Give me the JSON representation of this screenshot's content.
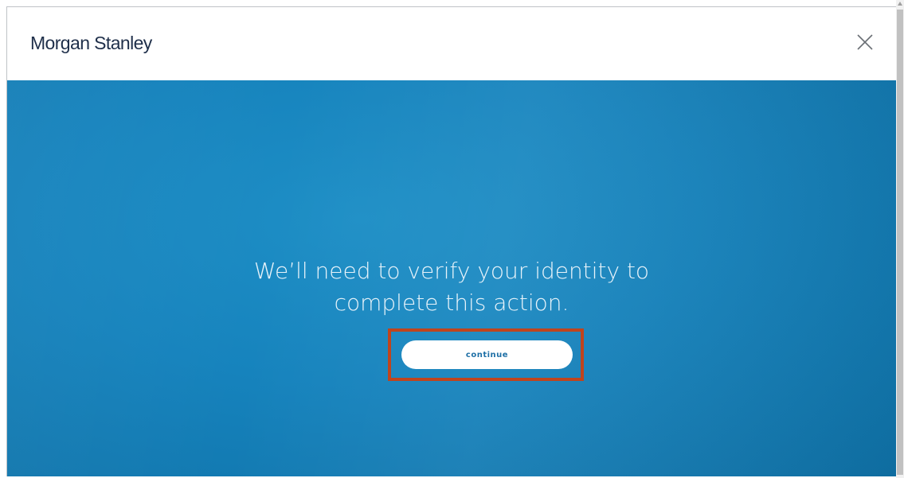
{
  "header": {
    "logo_text": "Morgan Stanley",
    "close_icon": "close-icon"
  },
  "hero": {
    "message_line1": "We’ll need to verify your identity to",
    "message_line2": "complete this action.",
    "continue_label": "continue"
  },
  "colors": {
    "hero_background": "#1683bd",
    "logo_text": "#1f2f4a",
    "highlight_border": "#c0441d",
    "button_background": "#ffffff",
    "button_text": "#1e6fa6"
  }
}
